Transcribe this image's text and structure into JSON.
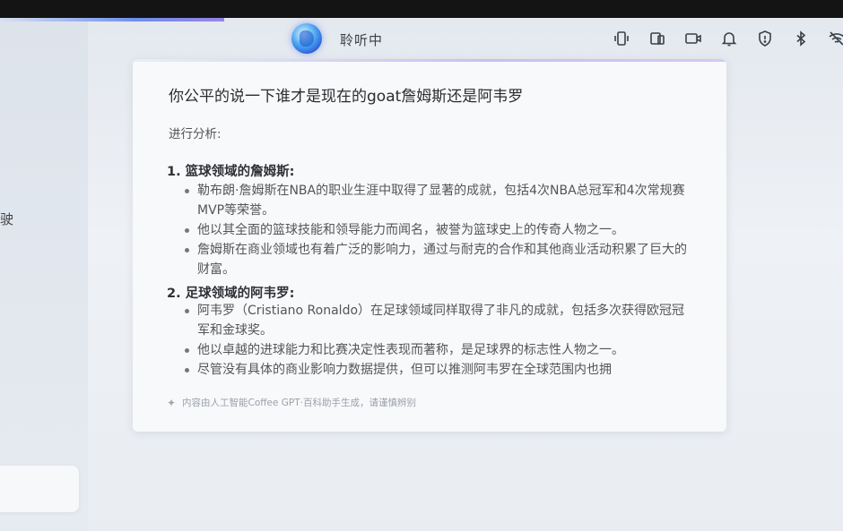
{
  "status": {
    "listening_label": "聆听中",
    "icons": [
      "vibrate-icon",
      "screen-cast-icon",
      "camera-icon",
      "bell-icon",
      "shield-icon",
      "bluetooth-icon",
      "wifi-off-icon"
    ]
  },
  "left": {
    "partial_text": "驶"
  },
  "card": {
    "question": "你公平的说一下谁才是现在的goat詹姆斯还是阿韦罗",
    "intro": "进行分析:",
    "sections": [
      {
        "title": "1. 篮球领域的詹姆斯:",
        "bullets": [
          "勒布朗·詹姆斯在NBA的职业生涯中取得了显著的成就，包括4次NBA总冠军和4次常规赛MVP等荣誉。",
          "他以其全面的篮球技能和领导能力而闻名，被誉为篮球史上的传奇人物之一。",
          "詹姆斯在商业领域也有着广泛的影响力，通过与耐克的合作和其他商业活动积累了巨大的财富。"
        ]
      },
      {
        "title": "2. 足球领域的阿韦罗:",
        "bullets": [
          "阿韦罗（Cristiano Ronaldo）在足球领域同样取得了非凡的成就，包括多次获得欧冠冠军和金球奖。",
          "他以卓越的进球能力和比赛决定性表现而著称，是足球界的标志性人物之一。",
          "尽管没有具体的商业影响力数据提供，但可以推测阿韦罗在全球范围内也拥"
        ]
      }
    ],
    "disclaimer": "内容由人工智能Coffee GPT·百科助手生成，请谨慎辨别"
  }
}
